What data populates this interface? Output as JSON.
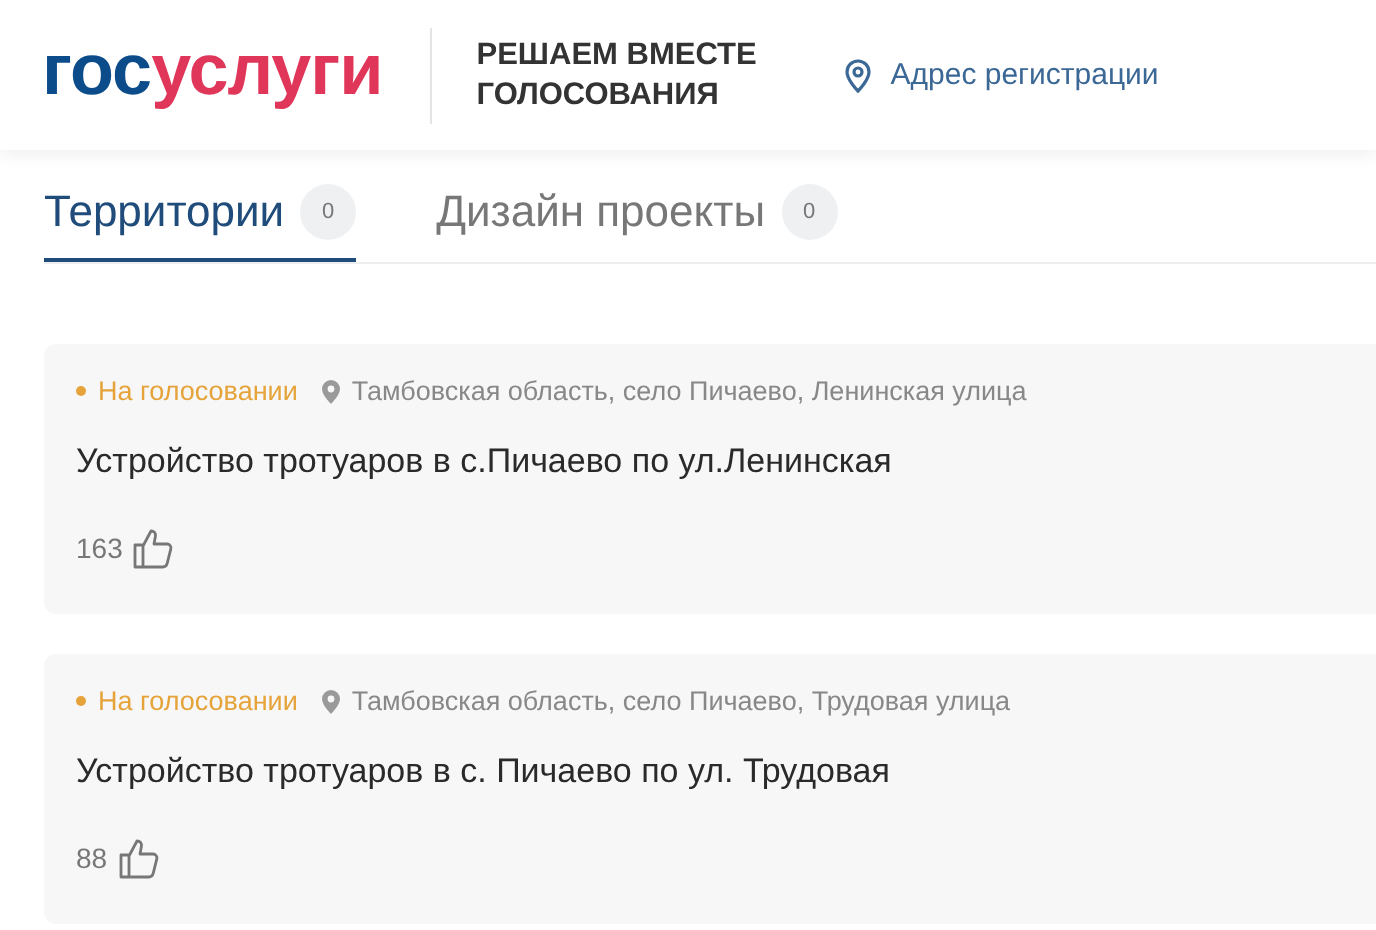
{
  "header": {
    "logo": {
      "first": "гос",
      "second": "услуги"
    },
    "tagline": "РЕШАЕМ ВМЕСТЕ ГОЛОСОВАНИЯ",
    "address_link": "Адрес регистрации"
  },
  "tabs": [
    {
      "label": "Территории",
      "count": "0",
      "selected": true
    },
    {
      "label": "Дизайн проекты",
      "count": "0",
      "selected": false
    }
  ],
  "projects": [
    {
      "status": "На голосовании",
      "location": "Тамбовская область, село Пичаево, Ленинская улица",
      "title": "Устройство тротуаров в с.Пичаево по ул.Ленинская",
      "likes": "163"
    },
    {
      "status": "На голосовании",
      "location": "Тамбовская область, село Пичаево, Трудовая улица",
      "title": "Устройство тротуаров в с. Пичаево по ул. Трудовая",
      "likes": "88"
    }
  ]
}
